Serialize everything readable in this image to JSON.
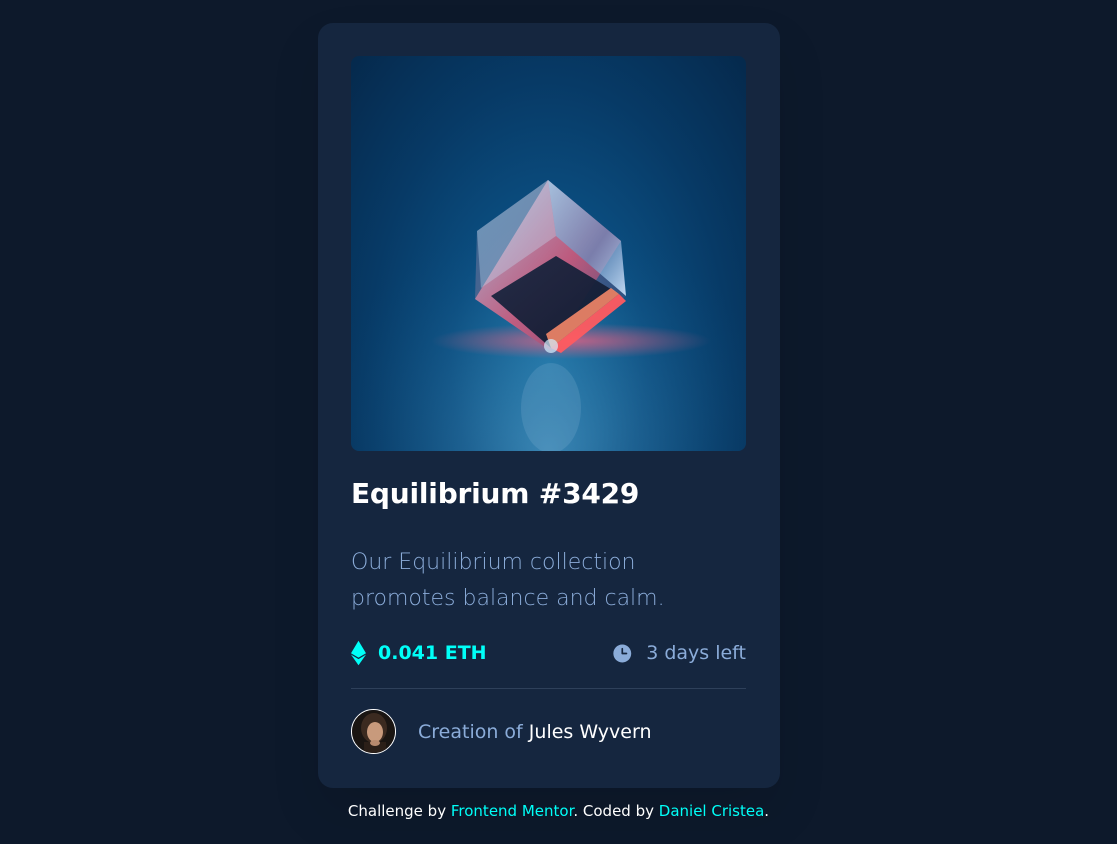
{
  "card": {
    "title": "Equilibrium #3429",
    "description": "Our Equilibrium collection promotes balance and calm.",
    "price": "0.041 ETH",
    "time_left": "3 days left",
    "creator_prefix": "Creation of",
    "creator_name": "Jules Wyvern"
  },
  "attribution": {
    "prefix": "Challenge by",
    "challenge_link": "Frontend Mentor",
    "middle": ". Coded by",
    "author_link": "Daniel Cristea",
    "suffix": "."
  },
  "colors": {
    "page_bg": "#0d192b",
    "card_bg": "#15263f",
    "accent_cyan": "#00fff8",
    "soft_blue": "#8bacd9",
    "white": "#ffffff",
    "divider": "#2e405a"
  },
  "icons": {
    "price": "ethereum-icon",
    "time": "clock-icon"
  }
}
